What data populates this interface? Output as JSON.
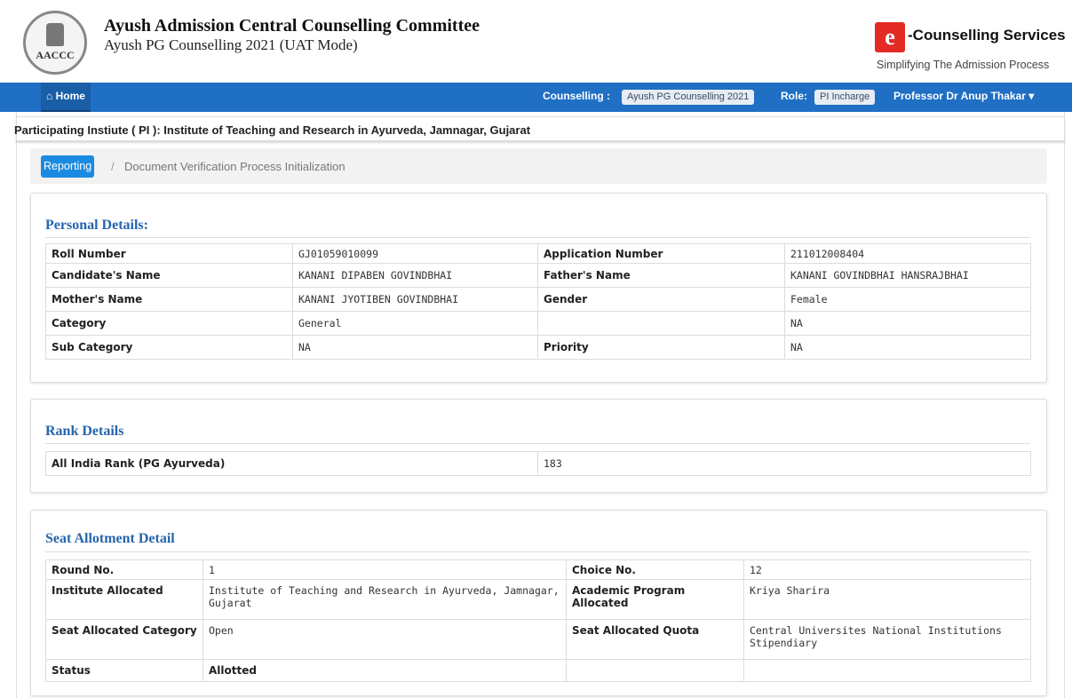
{
  "header": {
    "logo_text": "AACCC",
    "org_title": "Ayush Admission Central Counselling Committee",
    "org_subtitle": "Ayush PG Counselling 2021 (UAT Mode)",
    "brand_mark": "e",
    "brand_title": "-Counselling Services",
    "brand_tagline": "Simplifying The Admission Process"
  },
  "navbar": {
    "home_label": "Home",
    "counselling_label": "Counselling :",
    "counselling_value": "Ayush PG Counselling 2021",
    "role_label": "Role:",
    "role_value": "PI Incharge",
    "user_name": "Professor Dr Anup Thakar"
  },
  "pi_bar": {
    "text": "Participating Instiute ( PI ): Institute of Teaching and Research in Ayurveda, Jamnagar, Gujarat"
  },
  "breadcrumb": {
    "active": "Reporting",
    "separator": "/",
    "current": "Document Verification Process Initialization"
  },
  "personal": {
    "title": "Personal Details:",
    "rows": [
      [
        "Roll Number",
        "GJ01059010099",
        "Application Number",
        "211012008404"
      ],
      [
        "Candidate's Name",
        "KANANI DIPABEN GOVINDBHAI",
        "Father's Name",
        "KANANI GOVINDBHAI HANSRAJBHAI"
      ],
      [
        "Mother's Name",
        "KANANI JYOTIBEN GOVINDBHAI",
        "Gender",
        "Female"
      ],
      [
        "Category",
        "General",
        "",
        "NA"
      ],
      [
        "Sub Category",
        "NA",
        "Priority",
        "NA"
      ]
    ]
  },
  "rank": {
    "title": "Rank Details",
    "label": "All India Rank (PG Ayurveda)",
    "value": "183"
  },
  "seat": {
    "title": "Seat Allotment Detail",
    "rows": [
      [
        "Round No.",
        "1",
        "Choice No.",
        "12"
      ],
      [
        "Institute Allocated",
        "Institute of Teaching and Research in Ayurveda, Jamnagar, Gujarat",
        "Academic Program Allocated",
        "Kriya Sharira"
      ],
      [
        "Seat Allocated Category",
        "Open",
        "Seat Allocated Quota",
        "Central Universites National Institutions Stipendiary"
      ],
      [
        "Status",
        "Allotted",
        "",
        ""
      ]
    ]
  },
  "colors": {
    "navbar": "#1f6fc4",
    "section_title": "#2565ae",
    "crumb_active": "#1a8be0",
    "brand_red": "#e42a24"
  }
}
